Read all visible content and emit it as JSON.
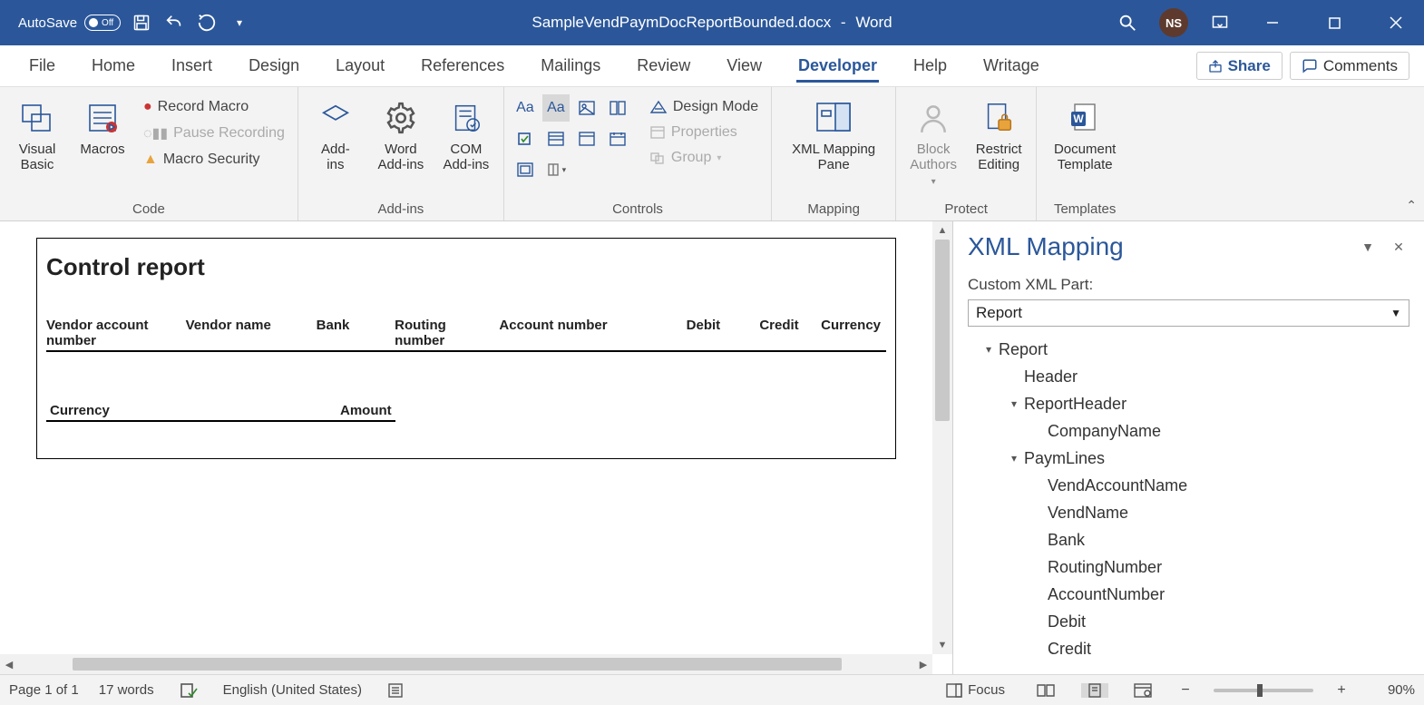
{
  "titlebar": {
    "autosave_label": "AutoSave",
    "autosave_state": "Off",
    "doc_name": "SampleVendPaymDocReportBounded.docx",
    "app_name": "Word",
    "avatar_initials": "NS"
  },
  "tabs": {
    "items": [
      "File",
      "Home",
      "Insert",
      "Design",
      "Layout",
      "References",
      "Mailings",
      "Review",
      "View",
      "Developer",
      "Help",
      "Writage"
    ],
    "active": "Developer",
    "share": "Share",
    "comments": "Comments"
  },
  "ribbon": {
    "code": {
      "label": "Code",
      "visual_basic": "Visual\nBasic",
      "macros": "Macros",
      "record_macro": "Record Macro",
      "pause_recording": "Pause Recording",
      "macro_security": "Macro Security"
    },
    "addins": {
      "label": "Add-ins",
      "addins": "Add-\nins",
      "word_addins": "Word\nAdd-ins",
      "com_addins": "COM\nAdd-ins"
    },
    "controls": {
      "label": "Controls",
      "design_mode": "Design Mode",
      "properties": "Properties",
      "group": "Group"
    },
    "mapping": {
      "label": "Mapping",
      "xml_mapping": "XML Mapping\nPane"
    },
    "protect": {
      "label": "Protect",
      "block_authors": "Block\nAuthors",
      "restrict_editing": "Restrict\nEditing"
    },
    "templates": {
      "label": "Templates",
      "doc_template": "Document\nTemplate"
    }
  },
  "document": {
    "title": "Control report",
    "columns": [
      "Vendor account number",
      "Vendor name",
      "Bank",
      "Routing number",
      "Account number",
      "Debit",
      "Credit",
      "Currency"
    ],
    "currency_label": "Currency",
    "amount_label": "Amount"
  },
  "pane": {
    "title": "XML Mapping",
    "subtitle": "Custom XML Part:",
    "selected": "Report",
    "tree": [
      {
        "level": 1,
        "twisty": "▾",
        "label": "Report"
      },
      {
        "level": 2,
        "twisty": "",
        "label": "Header"
      },
      {
        "level": 2,
        "twisty": "▾",
        "label": "ReportHeader"
      },
      {
        "level": 3,
        "twisty": "",
        "label": "CompanyName"
      },
      {
        "level": 2,
        "twisty": "▾",
        "label": "PaymLines"
      },
      {
        "level": 3,
        "twisty": "",
        "label": "VendAccountName"
      },
      {
        "level": 3,
        "twisty": "",
        "label": "VendName"
      },
      {
        "level": 3,
        "twisty": "",
        "label": "Bank"
      },
      {
        "level": 3,
        "twisty": "",
        "label": "RoutingNumber"
      },
      {
        "level": 3,
        "twisty": "",
        "label": "AccountNumber"
      },
      {
        "level": 3,
        "twisty": "",
        "label": "Debit"
      },
      {
        "level": 3,
        "twisty": "",
        "label": "Credit"
      }
    ]
  },
  "status": {
    "page": "Page 1 of 1",
    "words": "17 words",
    "language": "English (United States)",
    "focus": "Focus",
    "zoom": "90%"
  }
}
